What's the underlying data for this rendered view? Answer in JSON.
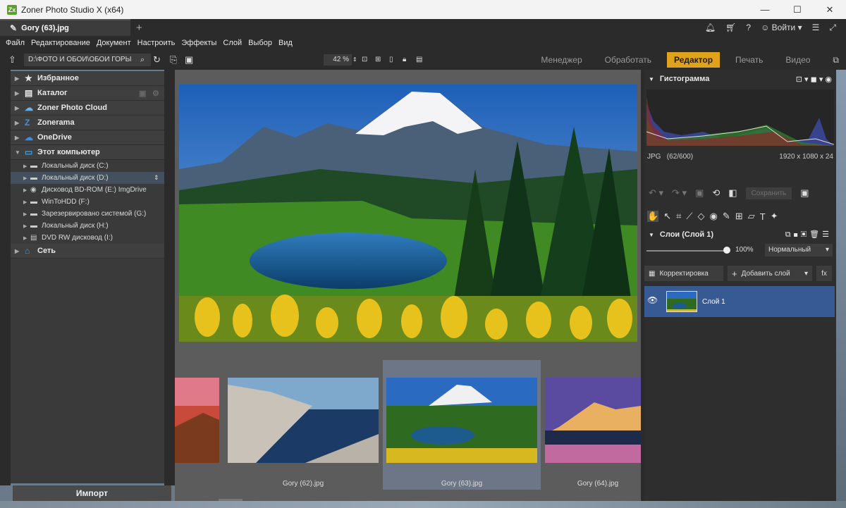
{
  "window": {
    "title": "Zoner Photo Studio X (x64)",
    "app_icon": "Zx"
  },
  "tab": {
    "label": "Gory (63).jpg"
  },
  "account": {
    "login_label": "Войти"
  },
  "menu": [
    "Файл",
    "Редактирование",
    "Документ",
    "Настроить",
    "Эффекты",
    "Слой",
    "Выбор",
    "Вид"
  ],
  "toolbar": {
    "path": "D:\\ФОТО И ОБОИ\\ОБОИ ГОРЫ",
    "zoom": "42 %"
  },
  "modes": [
    "Менеджер",
    "Обработать",
    "Редактор",
    "Печать",
    "Видео"
  ],
  "navigator": {
    "items": [
      {
        "label": "Избранное",
        "icon": "star-icon"
      },
      {
        "label": "Каталог",
        "icon": "catalog-icon"
      },
      {
        "label": "Zoner Photo Cloud",
        "icon": "cloud-icon"
      },
      {
        "label": "Zonerama",
        "icon": "zonerama-icon"
      },
      {
        "label": "OneDrive",
        "icon": "onedrive-icon"
      },
      {
        "label": "Этот компьютер",
        "icon": "computer-icon"
      }
    ],
    "drives": [
      "Локальный диск (C:)",
      "Локальный диск (D:)",
      "Дисковод BD-ROM (E:) ImgDrive",
      "WinToHDD (F:)",
      "Зарезервировано системой (G:)",
      "Локальный диск (H:)",
      "DVD RW дисковод (I:)"
    ],
    "network": "Сеть",
    "import_label": "Импорт"
  },
  "filmstrip": {
    "labels": [
      "Gory (62).jpg",
      "Gory (63).jpg",
      "Gory (64).jpg"
    ],
    "selected": "Gory (63).jpg"
  },
  "histogram": {
    "title": "Гистограмма",
    "format": "JPG",
    "index": "(62/600)",
    "dimensions": "1920 x 1080 x 24"
  },
  "edit": {
    "save_label": "Сохранить"
  },
  "layers": {
    "title": "Слои (Слой 1)",
    "opacity": "100%",
    "blend_mode": "Нормальный",
    "adjust_label": "Корректировка",
    "add_layer_label": "Добавить слой",
    "fx_label": "fx",
    "layer_name": "Слой 1"
  },
  "colors": {
    "accent": "#e0a21b",
    "selection": "#375a94",
    "panel": "#2e2e2e"
  }
}
